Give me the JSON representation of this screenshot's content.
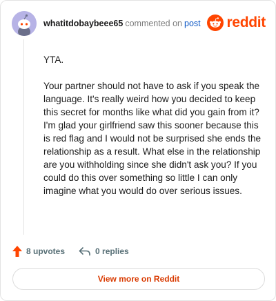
{
  "header": {
    "username": "whatitdobaybeee65",
    "action_text": "commented on",
    "post_link": "post",
    "brand_word": "reddit"
  },
  "comment": {
    "paragraphs": [
      "YTA.",
      "Your partner should not have to ask if you speak the language. It's really weird how you decided to keep this secret for months like what did you gain from it? I'm glad your girlfriend saw this sooner because this is red flag and I would not be surprised she ends the relationship as a result. What else in the relationship are you withholding since she didn't ask you? If you could do this over something so little I can only imagine what you would do over serious issues."
    ]
  },
  "footer": {
    "upvotes": "8 upvotes",
    "replies": "0 replies",
    "view_more": "View more on Reddit"
  },
  "colors": {
    "brand": "#ff4500",
    "link": "#0b56c4",
    "view_more_text": "#d93a00",
    "avatar_bg": "#b7b3e6"
  },
  "icons": {
    "avatar": "snoo-avatar-icon",
    "brand": "reddit-logo-icon",
    "upvote": "upvote-arrow-icon",
    "reply": "reply-arrow-icon"
  }
}
